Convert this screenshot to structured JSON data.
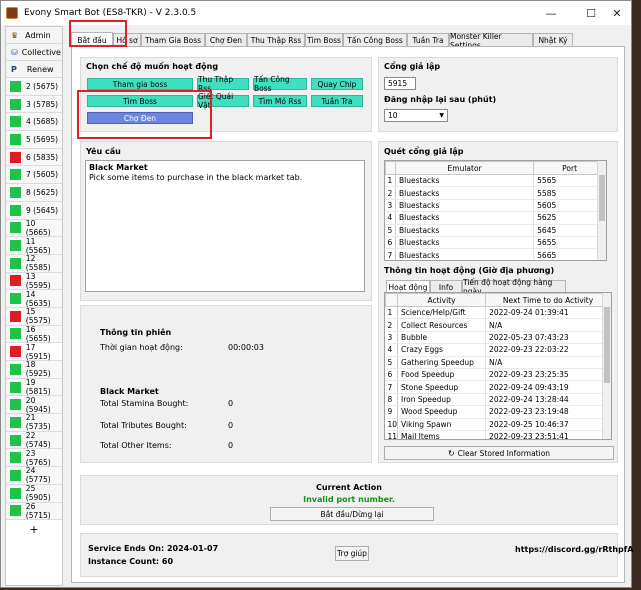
{
  "window": {
    "title": "Evony Smart Bot (ES8-TKR) - V 2.3.0.5",
    "minimize": "—",
    "maximize": "☐",
    "close": "✕"
  },
  "sidebar": {
    "admin": "Admin",
    "collective": "Collective",
    "renew": "Renew",
    "accounts": [
      {
        "label": "2 (5675)",
        "status": "green"
      },
      {
        "label": "3 (5785)",
        "status": "green"
      },
      {
        "label": "4 (5685)",
        "status": "green"
      },
      {
        "label": "5 (5695)",
        "status": "green"
      },
      {
        "label": "6 (5835)",
        "status": "red"
      },
      {
        "label": "7 (5605)",
        "status": "green"
      },
      {
        "label": "8 (5625)",
        "status": "green"
      },
      {
        "label": "9 (5645)",
        "status": "green"
      },
      {
        "label": "10 (5665)",
        "status": "green"
      },
      {
        "label": "11 (5565)",
        "status": "green"
      },
      {
        "label": "12 (5585)",
        "status": "green"
      },
      {
        "label": "13 (5595)",
        "status": "red"
      },
      {
        "label": "14 (5635)",
        "status": "green"
      },
      {
        "label": "15 (5575)",
        "status": "red"
      },
      {
        "label": "16 (5655)",
        "status": "green"
      },
      {
        "label": "17 (5915)",
        "status": "red"
      },
      {
        "label": "18 (5925)",
        "status": "green"
      },
      {
        "label": "19 (5815)",
        "status": "green"
      },
      {
        "label": "20 (5945)",
        "status": "green"
      },
      {
        "label": "21 (5735)",
        "status": "green"
      },
      {
        "label": "22 (5745)",
        "status": "green"
      },
      {
        "label": "23 (5765)",
        "status": "green"
      },
      {
        "label": "24 (5775)",
        "status": "green"
      },
      {
        "label": "25 (5905)",
        "status": "green"
      },
      {
        "label": "26 (5715)",
        "status": "green"
      }
    ],
    "add": "+"
  },
  "tabs": [
    "Bắt đầu",
    "Hồ sơ",
    "Tham Gia Boss",
    "Chợ Đen",
    "Thu Thập Rss",
    "Tìm Boss",
    "Tấn Công Boss",
    "Tuần Tra",
    "Monster Killer Settings",
    "Nhật Ký"
  ],
  "mode": {
    "title": "Chọn chế độ muốn hoạt động",
    "buttons": [
      "Tham gia boss",
      "Thu Thập Rss",
      "Tấn Công Boss",
      "Quay Chip",
      "Tìm Boss",
      "Giết Quái Vật",
      "Tìm Mỏ Rss",
      "Tuần Tra",
      "Chợ Đen"
    ]
  },
  "port": {
    "label": "Cổng giả lập",
    "value": "5915",
    "relogin_label": "Đăng nhập lại sau (phút)",
    "relogin_value": "10"
  },
  "requirement": {
    "label": "Yêu cầu",
    "heading": "Black Market",
    "text": "Pick some items to purchase in the black market tab."
  },
  "scan": {
    "label": "Quét cổng giả lập",
    "columns": [
      "Emulator",
      "Port"
    ],
    "rows": [
      [
        "1",
        "Bluestacks",
        "5565"
      ],
      [
        "2",
        "Bluestacks",
        "5585"
      ],
      [
        "3",
        "Bluestacks",
        "5605"
      ],
      [
        "4",
        "Bluestacks",
        "5625"
      ],
      [
        "5",
        "Bluestacks",
        "5645"
      ],
      [
        "6",
        "Bluestacks",
        "5655"
      ],
      [
        "7",
        "Bluestacks",
        "5665"
      ]
    ]
  },
  "session": {
    "title": "Thông tin phiên",
    "runtime_label": "Thời gian hoạt động:",
    "runtime_value": "00:00:03",
    "bm_title": "Black Market",
    "stamina_label": "Total Stamina Bought:",
    "stamina_value": "0",
    "tributes_label": "Total Tributes Bought:",
    "tributes_value": "0",
    "other_label": "Total Other Items:",
    "other_value": "0"
  },
  "activity": {
    "label": "Thông tin hoạt động (Giờ địa phương)",
    "subtabs": [
      "Hoạt động",
      "Info",
      "Tiến độ hoạt động hàng ngày"
    ],
    "columns": [
      "Activity",
      "Next Time to do Activity"
    ],
    "rows": [
      [
        "1",
        "Science/Help/Gift",
        "2022-09-24 01:39:41"
      ],
      [
        "2",
        "Collect Resources",
        "N/A"
      ],
      [
        "3",
        "Bubble",
        "2022-05-23 07:43:23"
      ],
      [
        "4",
        "Crazy Eggs",
        "2022-09-23 22:03:22"
      ],
      [
        "5",
        "Gathering Speedup",
        "N/A"
      ],
      [
        "6",
        "Food Speedup",
        "2022-09-23 23:25:35"
      ],
      [
        "7",
        "Stone Speedup",
        "2022-09-24 09:43:19"
      ],
      [
        "8",
        "Iron Speedup",
        "2022-09-24 13:28:44"
      ],
      [
        "9",
        "Wood Speedup",
        "2022-09-23 23:19:48"
      ],
      [
        "10",
        "Viking Spawn",
        "2022-09-25 10:46:37"
      ],
      [
        "11",
        "Mail Items",
        "2022-09-23 23:51:41"
      ]
    ],
    "clear_button": "Clear Stored Information"
  },
  "current_action": {
    "title": "Current Action",
    "status": "Invalid port number.",
    "button": "Bắt đầu/Dừng lại"
  },
  "footer": {
    "service": "Service Ends On: 2024-01-07",
    "instances": "Instance Count: 60",
    "help": "Trợ giúp",
    "discord": "https://discord.gg/rRthpfA"
  },
  "colors": {
    "green": "#1fc24a",
    "red": "#e01b24",
    "mode_button": "#3fe0c0",
    "mode_selected": "#6a86e0",
    "status_text": "#1a8f1a",
    "highlight": "#e0202a"
  }
}
